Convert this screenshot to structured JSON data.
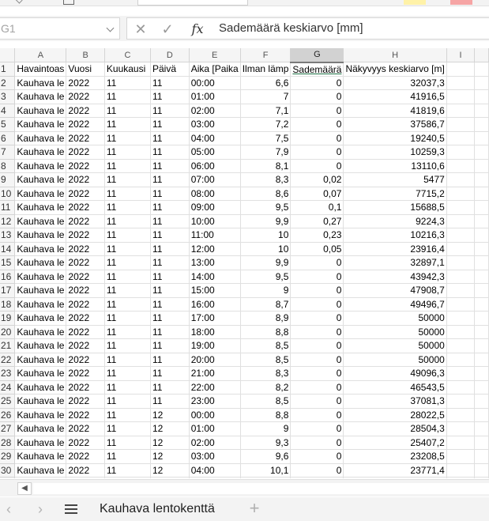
{
  "formula_bar": {
    "name_box": "G1",
    "cancel_glyph": "✕",
    "enter_glyph": "✓",
    "fx_label": "fx",
    "formula": "Sademäärä keskiarvo [mm]"
  },
  "columns": [
    "A",
    "B",
    "C",
    "D",
    "E",
    "F",
    "G",
    "H",
    "I"
  ],
  "selected_column": "G",
  "headers": [
    "Havaintoas",
    "Vuosi",
    "Kuukausi",
    "Päivä",
    "Aika [Paika",
    "Ilman lämp",
    "Sademäärä",
    "Näkyvyys keskiarvo [m]",
    ""
  ],
  "rows": [
    [
      "Kauhava le",
      "2022",
      "11",
      "11",
      "00:00",
      "6,6",
      "0",
      "32037,3"
    ],
    [
      "Kauhava le",
      "2022",
      "11",
      "11",
      "01:00",
      "7",
      "0",
      "41916,5"
    ],
    [
      "Kauhava le",
      "2022",
      "11",
      "11",
      "02:00",
      "7,1",
      "0",
      "41819,6"
    ],
    [
      "Kauhava le",
      "2022",
      "11",
      "11",
      "03:00",
      "7,2",
      "0",
      "37586,7"
    ],
    [
      "Kauhava le",
      "2022",
      "11",
      "11",
      "04:00",
      "7,5",
      "0",
      "19240,5"
    ],
    [
      "Kauhava le",
      "2022",
      "11",
      "11",
      "05:00",
      "7,9",
      "0",
      "10259,3"
    ],
    [
      "Kauhava le",
      "2022",
      "11",
      "11",
      "06:00",
      "8,1",
      "0",
      "13110,6"
    ],
    [
      "Kauhava le",
      "2022",
      "11",
      "11",
      "07:00",
      "8,3",
      "0,02",
      "5477"
    ],
    [
      "Kauhava le",
      "2022",
      "11",
      "11",
      "08:00",
      "8,6",
      "0,07",
      "7715,2"
    ],
    [
      "Kauhava le",
      "2022",
      "11",
      "11",
      "09:00",
      "9,5",
      "0,1",
      "15688,5"
    ],
    [
      "Kauhava le",
      "2022",
      "11",
      "11",
      "10:00",
      "9,9",
      "0,27",
      "9224,3"
    ],
    [
      "Kauhava le",
      "2022",
      "11",
      "11",
      "11:00",
      "10",
      "0,23",
      "10216,3"
    ],
    [
      "Kauhava le",
      "2022",
      "11",
      "11",
      "12:00",
      "10",
      "0,05",
      "23916,4"
    ],
    [
      "Kauhava le",
      "2022",
      "11",
      "11",
      "13:00",
      "9,9",
      "0",
      "32897,1"
    ],
    [
      "Kauhava le",
      "2022",
      "11",
      "11",
      "14:00",
      "9,5",
      "0",
      "43942,3"
    ],
    [
      "Kauhava le",
      "2022",
      "11",
      "11",
      "15:00",
      "9",
      "0",
      "47908,7"
    ],
    [
      "Kauhava le",
      "2022",
      "11",
      "11",
      "16:00",
      "8,7",
      "0",
      "49496,7"
    ],
    [
      "Kauhava le",
      "2022",
      "11",
      "11",
      "17:00",
      "8,9",
      "0",
      "50000"
    ],
    [
      "Kauhava le",
      "2022",
      "11",
      "11",
      "18:00",
      "8,8",
      "0",
      "50000"
    ],
    [
      "Kauhava le",
      "2022",
      "11",
      "11",
      "19:00",
      "8,5",
      "0",
      "50000"
    ],
    [
      "Kauhava le",
      "2022",
      "11",
      "11",
      "20:00",
      "8,5",
      "0",
      "50000"
    ],
    [
      "Kauhava le",
      "2022",
      "11",
      "11",
      "21:00",
      "8,3",
      "0",
      "49096,3"
    ],
    [
      "Kauhava le",
      "2022",
      "11",
      "11",
      "22:00",
      "8,2",
      "0",
      "46543,5"
    ],
    [
      "Kauhava le",
      "2022",
      "11",
      "11",
      "23:00",
      "8,5",
      "0",
      "37081,3"
    ],
    [
      "Kauhava le",
      "2022",
      "11",
      "12",
      "00:00",
      "8,8",
      "0",
      "28022,5"
    ],
    [
      "Kauhava le",
      "2022",
      "11",
      "12",
      "01:00",
      "9",
      "0",
      "28504,3"
    ],
    [
      "Kauhava le",
      "2022",
      "11",
      "12",
      "02:00",
      "9,3",
      "0",
      "25407,2"
    ],
    [
      "Kauhava le",
      "2022",
      "11",
      "12",
      "03:00",
      "9,6",
      "0",
      "23208,5"
    ],
    [
      "Kauhava le",
      "2022",
      "11",
      "12",
      "04:00",
      "10,1",
      "0",
      "23771,4"
    ]
  ],
  "tabbar": {
    "prev_glyph": "‹",
    "next_glyph": "›",
    "sheet_name": "Kauhava lentokenttä",
    "add_glyph": "+"
  },
  "scroll": {
    "left_glyph": "◀"
  }
}
